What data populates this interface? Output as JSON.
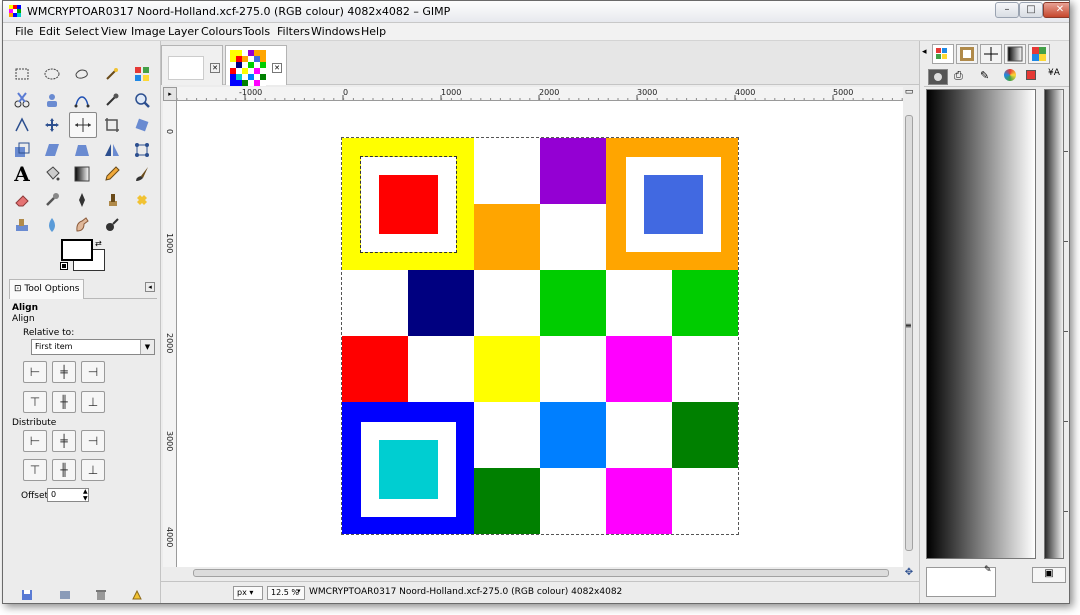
{
  "window": {
    "title": "WMCRYPTOAR0317 Noord-Holland.xcf-275.0 (RGB colour) 4082x4082 – GIMP",
    "minimize": "–",
    "maximize": "□",
    "close": "✕"
  },
  "menu": [
    {
      "label": "File"
    },
    {
      "label": "Edit"
    },
    {
      "label": "Select"
    },
    {
      "label": "View"
    },
    {
      "label": "Image"
    },
    {
      "label": "Layer"
    },
    {
      "label": "Colours"
    },
    {
      "label": "Tools"
    },
    {
      "label": "Filters"
    },
    {
      "label": "Windows"
    },
    {
      "label": "Help"
    }
  ],
  "toolbox": {
    "tools": [
      "rect-select-icon",
      "ellipse-select-icon",
      "free-select-icon",
      "fuzzy-select-icon",
      "color-select-icon",
      "scissors-icon",
      "foreground-select-icon",
      "paths-icon",
      "color-picker-icon",
      "zoom-icon",
      "measure-icon",
      "move-icon",
      "align-icon",
      "crop-icon",
      "rotate-icon",
      "scale-icon",
      "shear-icon",
      "perspective-icon",
      "flip-icon",
      "cage-icon",
      "text-icon",
      "bucket-fill-icon",
      "blend-icon",
      "pencil-icon",
      "paintbrush-icon",
      "eraser-icon",
      "airbrush-icon",
      "ink-icon",
      "clone-icon",
      "heal-icon",
      "perspective-clone-icon",
      "blur-icon",
      "smudge-icon",
      "dodge-burn-icon"
    ],
    "active_tool": "align-icon",
    "fg_color": "#000000",
    "bg_color": "#ffffff"
  },
  "tool_options": {
    "tab_label": "Tool Options",
    "heading": "Align",
    "subheading": "Align",
    "relative_to_label": "Relative to:",
    "relative_to_value": "First item",
    "distribute_label": "Distribute",
    "offset_label": "Offset:",
    "offset_value": "0"
  },
  "ruler": {
    "h_labels": [
      "-1000",
      "0",
      "1000",
      "2000",
      "3000",
      "4000",
      "5000"
    ],
    "v_labels": [
      "0",
      "1000",
      "2000",
      "3000",
      "4000"
    ]
  },
  "image": {
    "colors": [
      [
        "#ffff00",
        "#ffff00",
        "#ffffff",
        "#9400d3",
        "#ffa500",
        "#ffa500"
      ],
      [
        "#ffff00",
        "#ffff00",
        "#ffa500",
        "#ffffff",
        "#ffa500",
        "#ffa500"
      ],
      [
        "#ffffff",
        "#000080",
        "#ffffff",
        "#00cc00",
        "#ffffff",
        "#00cc00"
      ],
      [
        "#ff0000",
        "#ffffff",
        "#ffff00",
        "#ffffff",
        "#ff00ff",
        "#ffffff"
      ],
      [
        "#0000ff",
        "#0000ff",
        "#ffffff",
        "#007fff",
        "#ffffff",
        "#008000"
      ],
      [
        "#0000ff",
        "#0000ff",
        "#008000",
        "#ffffff",
        "#ff00ff",
        "#ffffff"
      ]
    ],
    "inner_squares": [
      {
        "frame": "#ffffff",
        "fill": "#ff0000"
      },
      {
        "frame": "#ffffff",
        "fill": "#4169e1"
      },
      {
        "frame": "#ffffff",
        "fill": "#00ced1"
      }
    ]
  },
  "statusbar": {
    "unit": "px",
    "zoom": "12.5 %",
    "info": "WMCRYPTOAR0317 Noord-Holland.xcf-275.0 (RGB colour) 4082x4082"
  }
}
